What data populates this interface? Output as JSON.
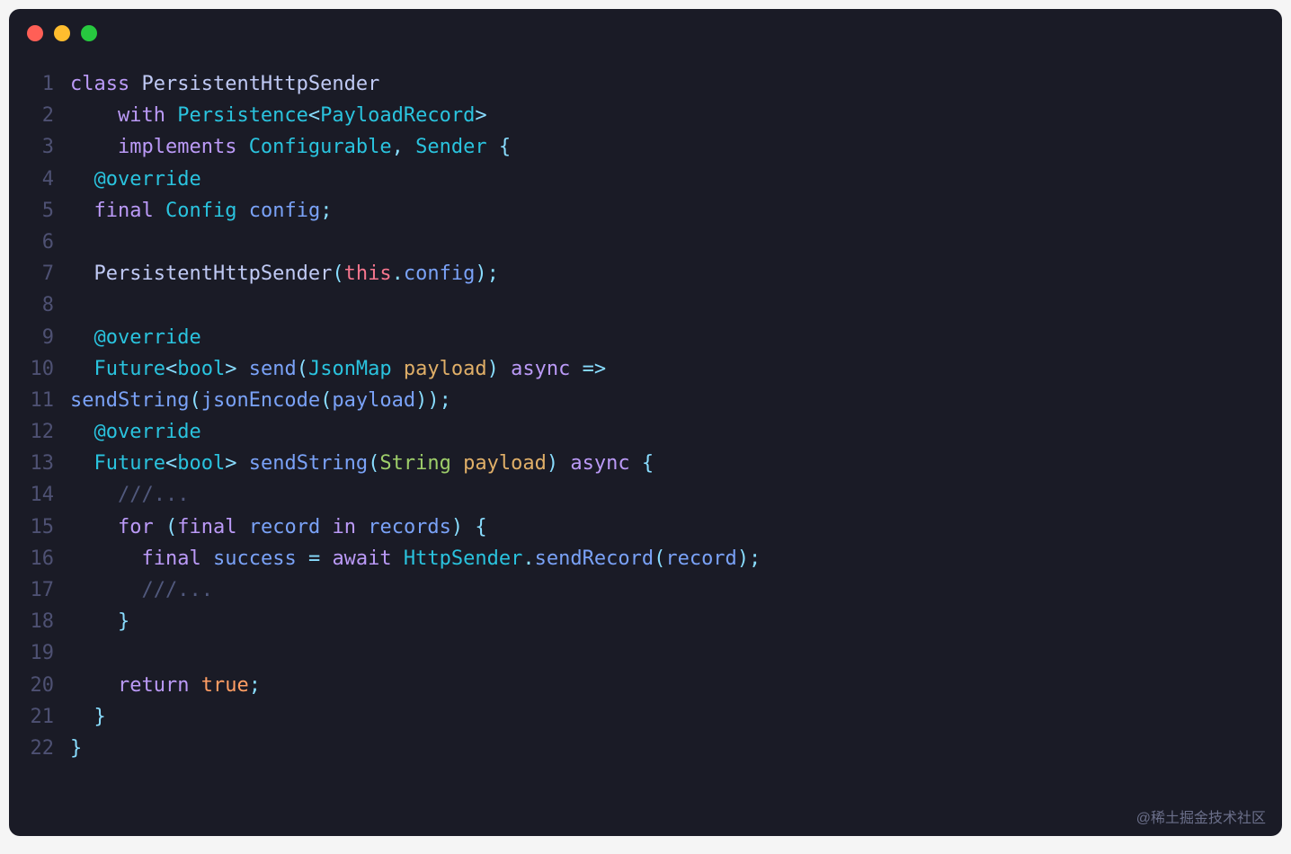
{
  "watermark": "@稀土掘金技术社区",
  "lines": [
    {
      "n": 1,
      "tokens": [
        {
          "c": "c-keyword",
          "t": "class"
        },
        {
          "c": "c-plain",
          "t": " "
        },
        {
          "c": "c-class",
          "t": "PersistentHttpSender"
        }
      ]
    },
    {
      "n": 2,
      "tokens": [
        {
          "c": "c-plain",
          "t": "    "
        },
        {
          "c": "c-keyword",
          "t": "with"
        },
        {
          "c": "c-plain",
          "t": " "
        },
        {
          "c": "c-type",
          "t": "Persistence"
        },
        {
          "c": "c-punct",
          "t": "<"
        },
        {
          "c": "c-type",
          "t": "PayloadRecord"
        },
        {
          "c": "c-punct",
          "t": ">"
        }
      ]
    },
    {
      "n": 3,
      "tokens": [
        {
          "c": "c-plain",
          "t": "    "
        },
        {
          "c": "c-keyword",
          "t": "implements"
        },
        {
          "c": "c-plain",
          "t": " "
        },
        {
          "c": "c-type",
          "t": "Configurable"
        },
        {
          "c": "c-punct",
          "t": ", "
        },
        {
          "c": "c-type",
          "t": "Sender"
        },
        {
          "c": "c-plain",
          "t": " "
        },
        {
          "c": "c-punct",
          "t": "{"
        }
      ]
    },
    {
      "n": 4,
      "tokens": [
        {
          "c": "c-plain",
          "t": "  "
        },
        {
          "c": "c-annot",
          "t": "@override"
        }
      ]
    },
    {
      "n": 5,
      "tokens": [
        {
          "c": "c-plain",
          "t": "  "
        },
        {
          "c": "c-keyword",
          "t": "final"
        },
        {
          "c": "c-plain",
          "t": " "
        },
        {
          "c": "c-type",
          "t": "Config"
        },
        {
          "c": "c-plain",
          "t": " "
        },
        {
          "c": "c-ident",
          "t": "config"
        },
        {
          "c": "c-punct",
          "t": ";"
        }
      ]
    },
    {
      "n": 6,
      "tokens": []
    },
    {
      "n": 7,
      "tokens": [
        {
          "c": "c-plain",
          "t": "  "
        },
        {
          "c": "c-class",
          "t": "PersistentHttpSender"
        },
        {
          "c": "c-punct",
          "t": "("
        },
        {
          "c": "c-this",
          "t": "this"
        },
        {
          "c": "c-punct",
          "t": "."
        },
        {
          "c": "c-ident",
          "t": "config"
        },
        {
          "c": "c-punct",
          "t": ");"
        }
      ]
    },
    {
      "n": 8,
      "tokens": []
    },
    {
      "n": 9,
      "tokens": [
        {
          "c": "c-plain",
          "t": "  "
        },
        {
          "c": "c-annot",
          "t": "@override"
        }
      ]
    },
    {
      "n": 10,
      "tokens": [
        {
          "c": "c-plain",
          "t": "  "
        },
        {
          "c": "c-type",
          "t": "Future"
        },
        {
          "c": "c-punct",
          "t": "<"
        },
        {
          "c": "c-type",
          "t": "bool"
        },
        {
          "c": "c-punct",
          "t": ">"
        },
        {
          "c": "c-plain",
          "t": " "
        },
        {
          "c": "c-method",
          "t": "send"
        },
        {
          "c": "c-punct",
          "t": "("
        },
        {
          "c": "c-type",
          "t": "JsonMap"
        },
        {
          "c": "c-plain",
          "t": " "
        },
        {
          "c": "c-yellow",
          "t": "payload"
        },
        {
          "c": "c-punct",
          "t": ")"
        },
        {
          "c": "c-plain",
          "t": " "
        },
        {
          "c": "c-async",
          "t": "async"
        },
        {
          "c": "c-plain",
          "t": " "
        },
        {
          "c": "c-punct",
          "t": "=>"
        }
      ]
    },
    {
      "n": 11,
      "tokens": [
        {
          "c": "c-method",
          "t": "sendString"
        },
        {
          "c": "c-punct",
          "t": "("
        },
        {
          "c": "c-call",
          "t": "jsonEncode"
        },
        {
          "c": "c-punct",
          "t": "("
        },
        {
          "c": "c-ident",
          "t": "payload"
        },
        {
          "c": "c-punct",
          "t": "));"
        }
      ]
    },
    {
      "n": 12,
      "tokens": [
        {
          "c": "c-plain",
          "t": "  "
        },
        {
          "c": "c-annot",
          "t": "@override"
        }
      ]
    },
    {
      "n": 13,
      "tokens": [
        {
          "c": "c-plain",
          "t": "  "
        },
        {
          "c": "c-type",
          "t": "Future"
        },
        {
          "c": "c-punct",
          "t": "<"
        },
        {
          "c": "c-type",
          "t": "bool"
        },
        {
          "c": "c-punct",
          "t": ">"
        },
        {
          "c": "c-plain",
          "t": " "
        },
        {
          "c": "c-method",
          "t": "sendString"
        },
        {
          "c": "c-punct",
          "t": "("
        },
        {
          "c": "c-green",
          "t": "String"
        },
        {
          "c": "c-plain",
          "t": " "
        },
        {
          "c": "c-yellow",
          "t": "payload"
        },
        {
          "c": "c-punct",
          "t": ")"
        },
        {
          "c": "c-plain",
          "t": " "
        },
        {
          "c": "c-async",
          "t": "async"
        },
        {
          "c": "c-plain",
          "t": " "
        },
        {
          "c": "c-punct",
          "t": "{"
        }
      ]
    },
    {
      "n": 14,
      "tokens": [
        {
          "c": "c-plain",
          "t": "    "
        },
        {
          "c": "c-comment",
          "t": "///..."
        }
      ]
    },
    {
      "n": 15,
      "tokens": [
        {
          "c": "c-plain",
          "t": "    "
        },
        {
          "c": "c-keyword",
          "t": "for"
        },
        {
          "c": "c-plain",
          "t": " "
        },
        {
          "c": "c-punct",
          "t": "("
        },
        {
          "c": "c-keyword",
          "t": "final"
        },
        {
          "c": "c-plain",
          "t": " "
        },
        {
          "c": "c-ident",
          "t": "record"
        },
        {
          "c": "c-plain",
          "t": " "
        },
        {
          "c": "c-keyword",
          "t": "in"
        },
        {
          "c": "c-plain",
          "t": " "
        },
        {
          "c": "c-ident",
          "t": "records"
        },
        {
          "c": "c-punct",
          "t": ")"
        },
        {
          "c": "c-plain",
          "t": " "
        },
        {
          "c": "c-punct",
          "t": "{"
        }
      ]
    },
    {
      "n": 16,
      "tokens": [
        {
          "c": "c-plain",
          "t": "      "
        },
        {
          "c": "c-keyword",
          "t": "final"
        },
        {
          "c": "c-plain",
          "t": " "
        },
        {
          "c": "c-ident",
          "t": "success"
        },
        {
          "c": "c-plain",
          "t": " "
        },
        {
          "c": "c-punct",
          "t": "="
        },
        {
          "c": "c-plain",
          "t": " "
        },
        {
          "c": "c-keyword",
          "t": "await"
        },
        {
          "c": "c-plain",
          "t": " "
        },
        {
          "c": "c-static",
          "t": "HttpSender"
        },
        {
          "c": "c-punct",
          "t": "."
        },
        {
          "c": "c-method",
          "t": "sendRecord"
        },
        {
          "c": "c-punct",
          "t": "("
        },
        {
          "c": "c-ident",
          "t": "record"
        },
        {
          "c": "c-punct",
          "t": ");"
        }
      ]
    },
    {
      "n": 17,
      "tokens": [
        {
          "c": "c-plain",
          "t": "      "
        },
        {
          "c": "c-comment",
          "t": "///..."
        }
      ]
    },
    {
      "n": 18,
      "tokens": [
        {
          "c": "c-plain",
          "t": "    "
        },
        {
          "c": "c-punct",
          "t": "}"
        }
      ]
    },
    {
      "n": 19,
      "tokens": []
    },
    {
      "n": 20,
      "tokens": [
        {
          "c": "c-plain",
          "t": "    "
        },
        {
          "c": "c-keyword",
          "t": "return"
        },
        {
          "c": "c-plain",
          "t": " "
        },
        {
          "c": "c-true",
          "t": "true"
        },
        {
          "c": "c-punct",
          "t": ";"
        }
      ]
    },
    {
      "n": 21,
      "tokens": [
        {
          "c": "c-plain",
          "t": "  "
        },
        {
          "c": "c-punct",
          "t": "}"
        }
      ]
    },
    {
      "n": 22,
      "tokens": [
        {
          "c": "c-punct",
          "t": "}"
        }
      ]
    }
  ]
}
